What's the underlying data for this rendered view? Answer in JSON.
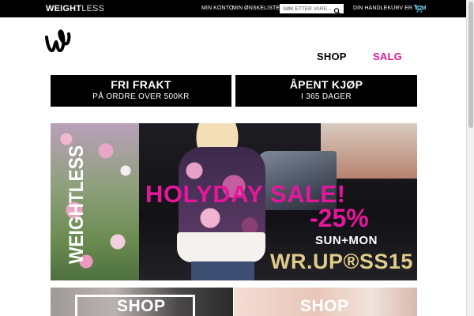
{
  "topbar": {
    "brand_bold": "WEIGHT",
    "brand_light": "LESS",
    "my_account": "MIN KONTO",
    "wishlist": "MIN ØNSKELISTE",
    "search_placeholder": "SØK ETTER VARE...",
    "cart_text": "DIN HANDLEKURV ER TOM",
    "search_icon": "magnifier-icon",
    "cart_icon": "shopping-cart-icon"
  },
  "logo": {
    "icon": "wl-logo-icon"
  },
  "nav": {
    "shop": "SHOP",
    "salg": "SALG",
    "salg_color": "#e5169b"
  },
  "info_boxes": [
    {
      "title": "FRI FRAKT",
      "subtitle": "PÅ ORDRE OVER 500KR"
    },
    {
      "title": "ÅPENT KJØP",
      "subtitle": "I 365 DAGER"
    }
  ],
  "banner": {
    "vertical_brand": "WEIGHTLESS",
    "headline": "HOLYDAY SALE!",
    "discount": "-25%",
    "days": "SUN+MON",
    "collection": "WR.UP®SS15",
    "accent_color": "#e5169b"
  },
  "tiles": [
    {
      "label": "SHOP"
    },
    {
      "label": "SHOP"
    }
  ]
}
